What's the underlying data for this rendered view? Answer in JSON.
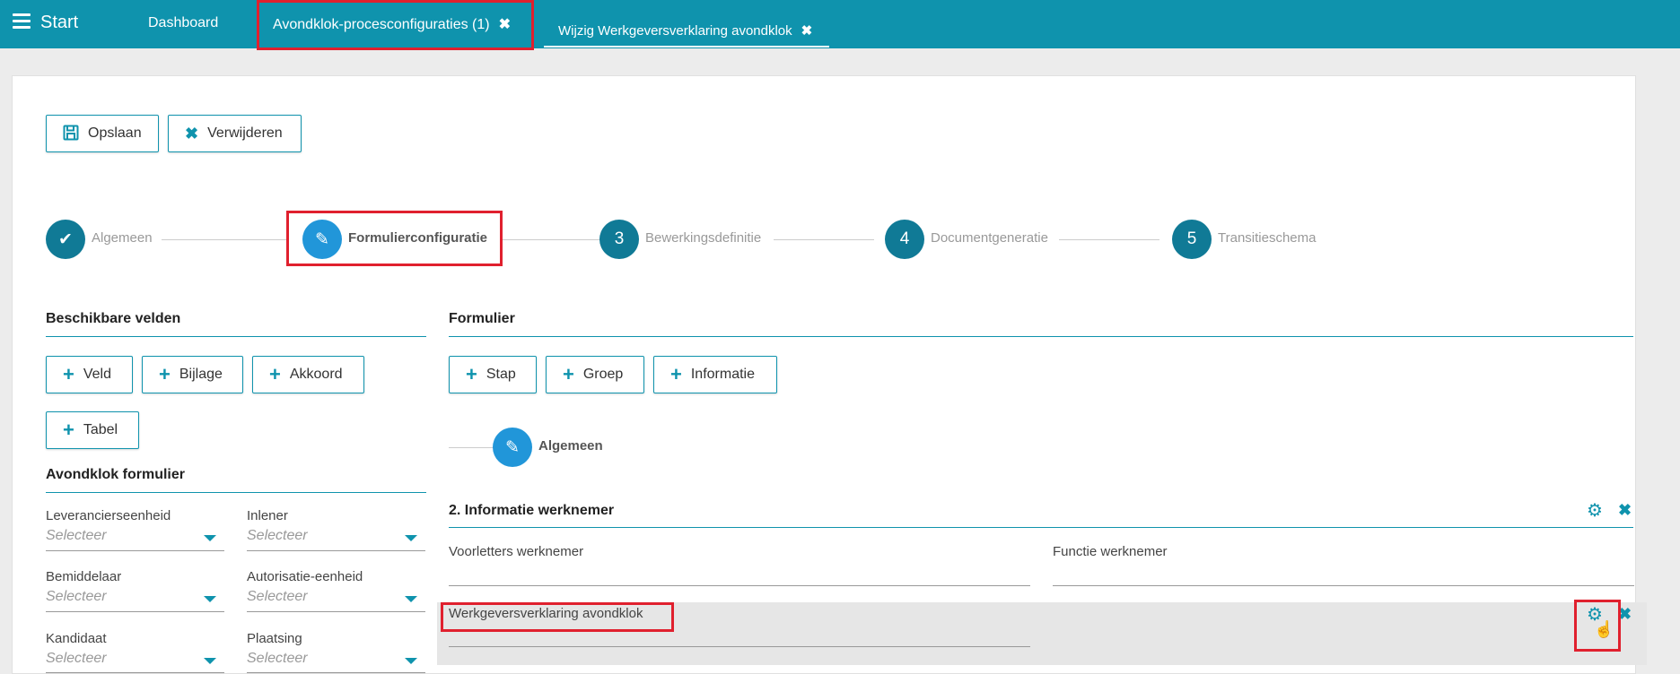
{
  "topbar": {
    "start_label": "Start",
    "tabs": [
      {
        "label": "Dashboard"
      },
      {
        "label": "Avondklok-procesconfiguraties (1)",
        "close": "✖"
      },
      {
        "label": "Wijzig Werkgeversverklaring avondklok",
        "close": "✖"
      }
    ]
  },
  "toolbar": {
    "save_label": "Opslaan",
    "delete_label": "Verwijderen"
  },
  "stepper": {
    "steps": [
      {
        "label": "Algemeen",
        "marker": "✔"
      },
      {
        "label": "Formulierconfiguratie",
        "marker": "✎"
      },
      {
        "label": "Bewerkingsdefinitie",
        "marker": "3"
      },
      {
        "label": "Documentgeneratie",
        "marker": "4"
      },
      {
        "label": "Transitieschema",
        "marker": "5"
      }
    ]
  },
  "available_fields": {
    "title": "Beschikbare velden",
    "buttons": [
      "Veld",
      "Bijlage",
      "Akkoord",
      "Tabel"
    ]
  },
  "avondklok_form": {
    "title": "Avondklok formulier",
    "fields": [
      {
        "label": "Leverancierseenheid",
        "placeholder": "Selecteer"
      },
      {
        "label": "Inlener",
        "placeholder": "Selecteer"
      },
      {
        "label": "Bemiddelaar",
        "placeholder": "Selecteer"
      },
      {
        "label": "Autorisatie-eenheid",
        "placeholder": "Selecteer"
      },
      {
        "label": "Kandidaat",
        "placeholder": "Selecteer"
      },
      {
        "label": "Plaatsing",
        "placeholder": "Selecteer"
      }
    ]
  },
  "formulier": {
    "title": "Formulier",
    "buttons": [
      "Stap",
      "Groep",
      "Informatie"
    ],
    "substep_label": "Algemeen",
    "group_title": "2. Informatie werknemer",
    "fields": [
      {
        "label": "Voorletters werknemer"
      },
      {
        "label": "Functie werknemer"
      },
      {
        "label": "Werkgeversverklaring avondklok"
      }
    ]
  },
  "colors": {
    "accent": "#0f93ad",
    "active_step": "#2196d9",
    "highlight": "#e0202e"
  }
}
